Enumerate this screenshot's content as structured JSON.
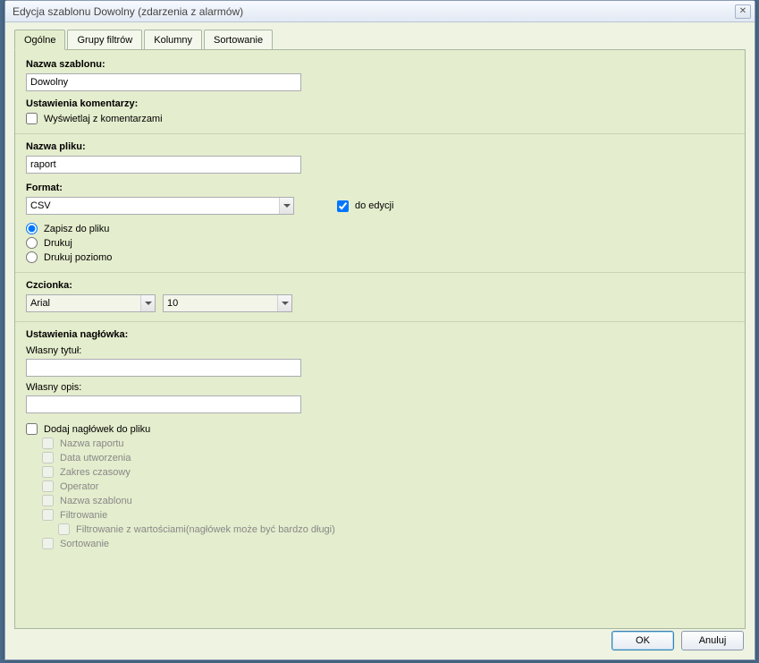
{
  "window": {
    "title": "Edycja szablonu Dowolny (zdarzenia z alarmów)"
  },
  "tabs": {
    "general": "Ogólne",
    "filter_groups": "Grupy filtrów",
    "columns": "Kolumny",
    "sorting": "Sortowanie"
  },
  "template_name": {
    "label": "Nazwa szablonu:",
    "value": "Dowolny"
  },
  "comment_settings": {
    "label": "Ustawienia komentarzy:",
    "show_with_comments": "Wyświetlaj z komentarzami"
  },
  "file_name": {
    "label": "Nazwa pliku:",
    "value": "raport"
  },
  "format": {
    "label": "Format:",
    "value": "CSV",
    "editable": "do edycji",
    "save_to_file": "Zapisz do pliku",
    "print": "Drukuj",
    "print_landscape": "Drukuj poziomo"
  },
  "font": {
    "label": "Czcionka:",
    "family": "Arial",
    "size": "10"
  },
  "header": {
    "label": "Ustawienia nagłówka:",
    "own_title": "Własny tytuł:",
    "own_desc": "Własny opis:",
    "add_header_to_file": "Dodaj nagłówek do pliku",
    "items": {
      "report_name": "Nazwa raportu",
      "creation_date": "Data utworzenia",
      "time_range": "Zakres czasowy",
      "operator": "Operator",
      "template_name": "Nazwa szablonu",
      "filtering": "Filtrowanie",
      "filtering_with_values": "Filtrowanie z wartościami(nagłówek może być bardzo długi)",
      "sorting": "Sortowanie"
    }
  },
  "buttons": {
    "ok": "OK",
    "cancel": "Anuluj"
  }
}
